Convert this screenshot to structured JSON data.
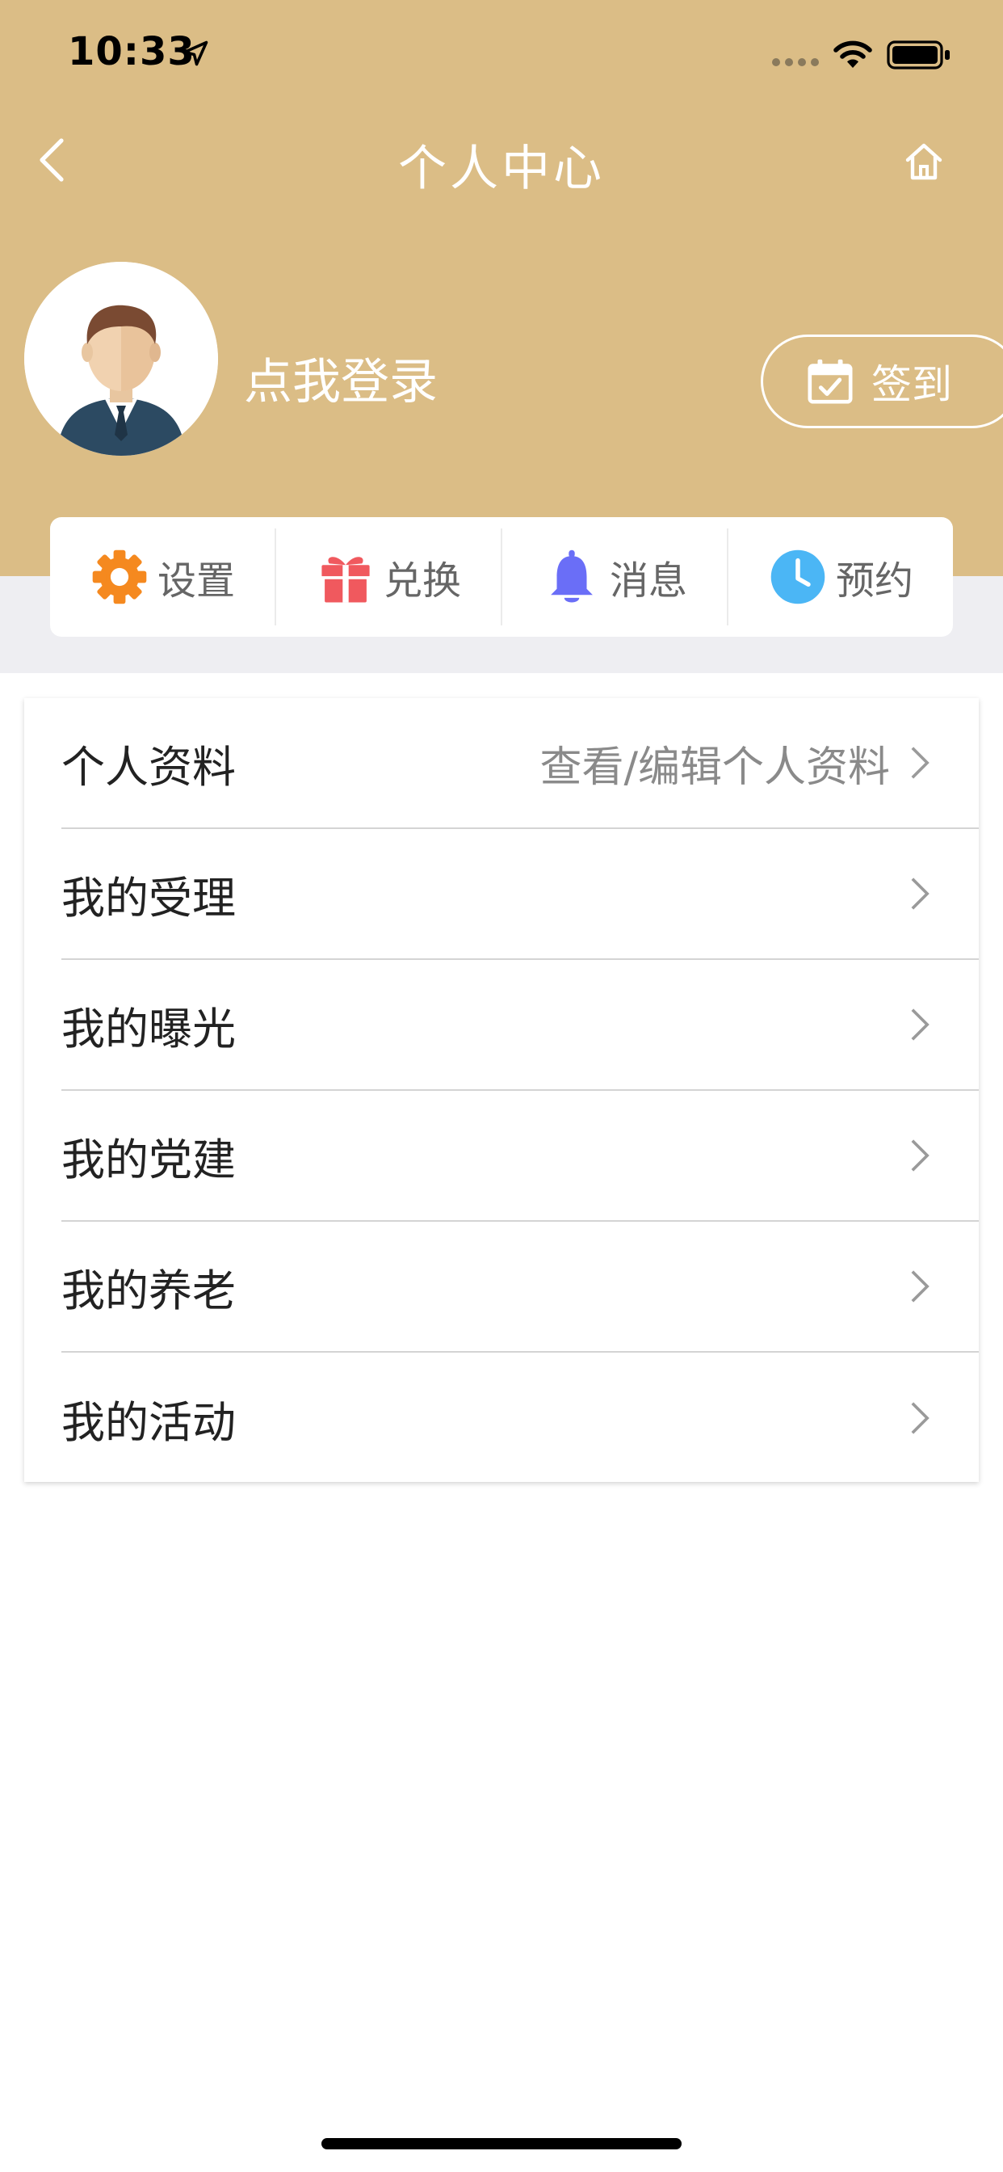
{
  "status_bar": {
    "time": "10:33",
    "icons": [
      "location-arrow-icon",
      "signal-dots-icon",
      "wifi-icon",
      "battery-icon"
    ]
  },
  "nav": {
    "title": "个人中心",
    "back_icon": "chevron-left-icon",
    "home_icon": "home-icon"
  },
  "profile": {
    "login_text": "点我登录",
    "avatar_icon": "user-avatar-icon",
    "checkin_label": "签到",
    "checkin_icon": "calendar-check-icon"
  },
  "quick_actions": [
    {
      "label": "设置",
      "icon": "gear-icon",
      "color": "#f5891f"
    },
    {
      "label": "兑换",
      "icon": "gift-icon",
      "color": "#f0595e"
    },
    {
      "label": "消息",
      "icon": "bell-icon",
      "color": "#6a6ef7"
    },
    {
      "label": "预约",
      "icon": "clock-icon",
      "color": "#4bb6f5"
    }
  ],
  "menu": [
    {
      "label": "个人资料",
      "hint": "查看/编辑个人资料"
    },
    {
      "label": "我的受理",
      "hint": ""
    },
    {
      "label": "我的曝光",
      "hint": ""
    },
    {
      "label": "我的党建",
      "hint": ""
    },
    {
      "label": "我的养老",
      "hint": ""
    },
    {
      "label": "我的活动",
      "hint": ""
    }
  ],
  "colors": {
    "header_bg": "#dbbd86",
    "band_bg": "#eeeef2",
    "text_primary": "#222222",
    "text_secondary": "#8a8a8a"
  }
}
